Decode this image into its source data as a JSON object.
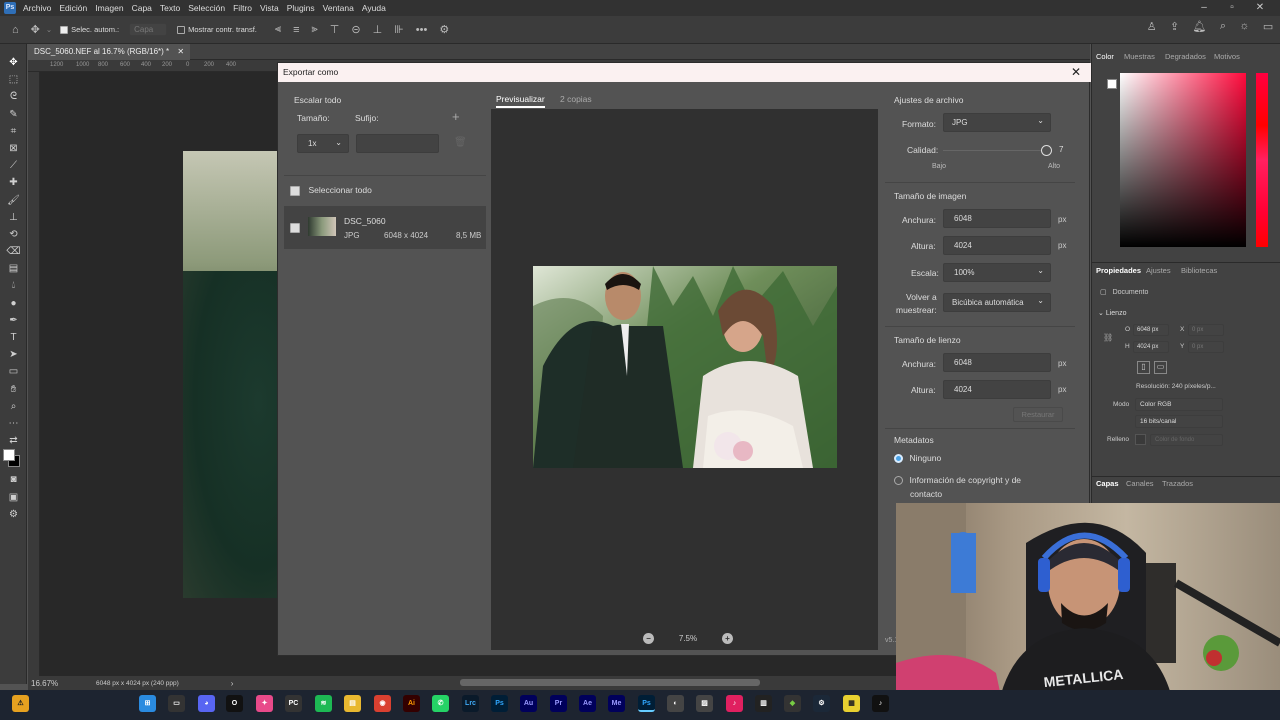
{
  "menu": {
    "app_icon": "Ps",
    "items": [
      "Archivo",
      "Edición",
      "Imagen",
      "Capa",
      "Texto",
      "Selección",
      "Filtro",
      "Vista",
      "Plugins",
      "Ventana",
      "Ayuda"
    ]
  },
  "options_bar": {
    "auto_select_label": "Selec. autom.:",
    "layer_value": "Capa",
    "transform_label": "Mostrar contr. transf."
  },
  "document": {
    "tab_title": "DSC_5060.NEF al 16.7% (RGB/16*) *",
    "zoom": "16.67%",
    "info": "6048 px x 4024 px (240 ppp)",
    "ruler_ticks": [
      "1200",
      "1000",
      "800",
      "600",
      "400",
      "200",
      "0",
      "200",
      "400"
    ]
  },
  "dialog": {
    "title": "Exportar como",
    "scale_all": "Escalar todo",
    "size_label": "Tamaño:",
    "suffix_label": "Sufijo:",
    "size_value": "1x",
    "select_all": "Seleccionar todo",
    "asset": {
      "name": "DSC_5060",
      "format": "JPG",
      "dimensions": "6048 x 4024",
      "filesize": "8,5 MB"
    },
    "preview_tab": "Previsualizar",
    "copies_tab": "2 copias",
    "zoom_value": "7.5%",
    "file_settings": {
      "title": "Ajustes de archivo",
      "format_label": "Formato:",
      "format_value": "JPG",
      "quality_label": "Calidad:",
      "quality_value": "7",
      "low": "Bajo",
      "high": "Alto"
    },
    "image_size": {
      "title": "Tamaño de imagen",
      "width_label": "Anchura:",
      "width_value": "6048",
      "height_label": "Altura:",
      "height_value": "4024",
      "unit": "px",
      "scale_label": "Escala:",
      "scale_value": "100%",
      "resample_label_1": "Volver a",
      "resample_label_2": "muestrear:",
      "resample_value": "Bicúbica automática"
    },
    "canvas_size": {
      "title": "Tamaño de lienzo",
      "width_label": "Anchura:",
      "width_value": "6048",
      "height_label": "Altura:",
      "height_value": "4024",
      "unit": "px",
      "reset": "Restaurar"
    },
    "metadata": {
      "title": "Metadatos",
      "none": "Ninguno",
      "copyright_1": "Información de copyright y de",
      "copyright_2": "contacto"
    },
    "version": "v5.1"
  },
  "panels": {
    "color_tabs": [
      "Color",
      "Muestras",
      "Degradados",
      "Motivos"
    ],
    "props_tabs": [
      "Propiedades",
      "Ajustes",
      "Bibliotecas"
    ],
    "document_label": "Documento",
    "canvas_label": "Lienzo",
    "w_label": "O",
    "w_value": "6048 px",
    "h_label": "H",
    "h_value": "4024 px",
    "x_label": "X",
    "x_value": "0 px",
    "y_label": "Y",
    "y_value": "0 px",
    "resolution": "Resolución: 240 píxeles/p...",
    "mode_label": "Modo",
    "mode_value": "Color RGB",
    "depth_value": "16 bits/canal",
    "fill_label": "Relleno",
    "fill_value": "Color de fondo",
    "layers_tabs": [
      "Capas",
      "Canales",
      "Trazados"
    ]
  },
  "taskbar": {
    "apps": [
      "",
      "",
      "",
      "O",
      "",
      "PC",
      "",
      "",
      "",
      "Ai",
      "",
      "Lrc",
      "Ps",
      "Au",
      "Pr",
      "Ae",
      "Me",
      "Ps",
      "",
      "",
      "",
      "",
      "",
      "",
      "",
      "",
      ""
    ]
  }
}
